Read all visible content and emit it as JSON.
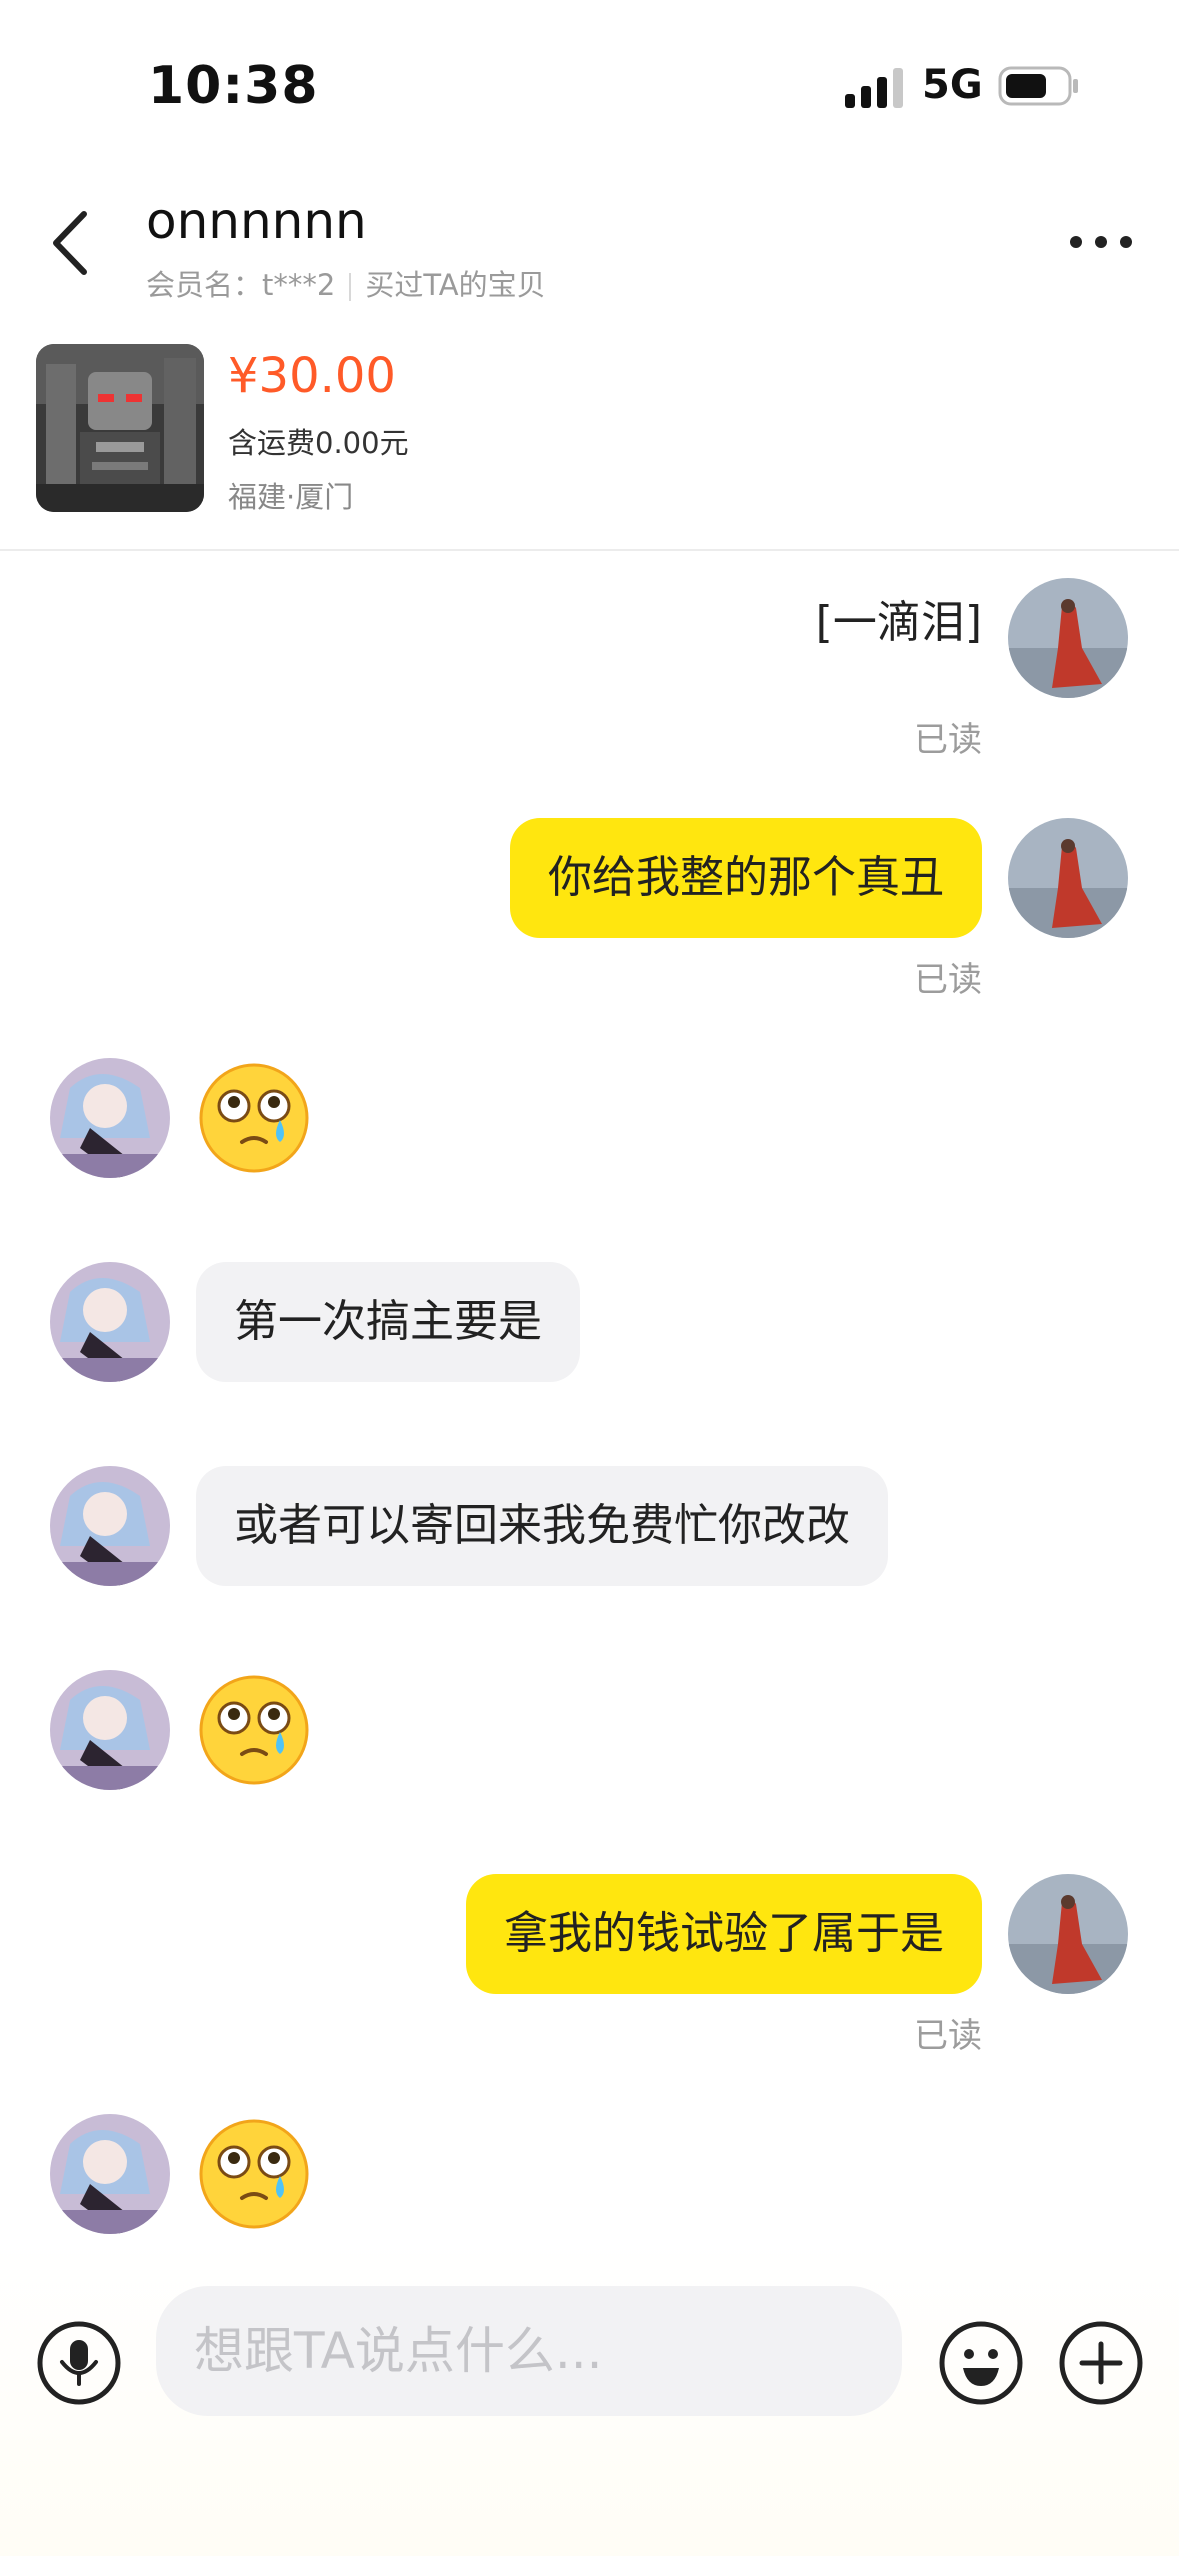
{
  "status_bar": {
    "time": "10:38",
    "network": "5G",
    "icons": [
      "signal-icon",
      "battery-icon"
    ]
  },
  "header": {
    "contact_name": "onnnnnn",
    "member_label": "会员名：t***2",
    "purchase_label": "买过TA的宝贝",
    "icons": [
      "back-icon",
      "more-icon"
    ]
  },
  "product": {
    "price": "¥30.00",
    "shipping": "含运费0.00元",
    "location": "福建·厦门"
  },
  "messages": [
    {
      "from": "me",
      "type": "text-plain",
      "text": "[一滴泪]",
      "status": "已读"
    },
    {
      "from": "me",
      "type": "text",
      "text": "你给我整的那个真丑",
      "status": "已读"
    },
    {
      "from": "other",
      "type": "emoji",
      "emoji": "crying-face-emoji"
    },
    {
      "from": "other",
      "type": "text",
      "text": "第一次搞主要是"
    },
    {
      "from": "other",
      "type": "text",
      "text": "或者可以寄回来我免费忙你改改"
    },
    {
      "from": "other",
      "type": "emoji",
      "emoji": "crying-face-emoji"
    },
    {
      "from": "me",
      "type": "text",
      "text": "拿我的钱试验了属于是",
      "status": "已读"
    },
    {
      "from": "other",
      "type": "emoji",
      "emoji": "crying-face-emoji"
    }
  ],
  "input_bar": {
    "placeholder": "想跟TA说点什么...",
    "icons": [
      "microphone-icon",
      "emoji-icon",
      "plus-icon"
    ]
  },
  "colors": {
    "accent_yellow": "#FFE60F",
    "price_orange": "#FF5A28",
    "incoming_bubble": "#F2F2F4"
  }
}
